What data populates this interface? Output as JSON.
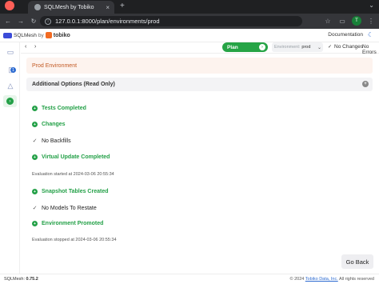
{
  "browser": {
    "tab_title": "SQLMesh by Tobiko",
    "tab_close": "×",
    "new_tab": "+",
    "url": "127.0.0.1:8000/plan/environments/prod",
    "avatar_letter": "T"
  },
  "app": {
    "brand_name": "SQLMesh",
    "brand_by": "by",
    "brand_company": "tobiko",
    "docs_label": "Documentation"
  },
  "sidebar": {
    "badge_count": "1"
  },
  "controls": {
    "back_arrow": "‹",
    "forward_arrow": "›",
    "plan_label": "Plan",
    "environment_label": "Environment:",
    "environment_value": "prod",
    "no_changes": "No Changes",
    "no_errors": "No Errors"
  },
  "main": {
    "prod_environment": "Prod Environment",
    "additional_options": "Additional Options (Read Only)",
    "steps": [
      {
        "label": "Tests Completed"
      },
      {
        "label": "Changes"
      },
      {
        "label": "No Backfills"
      },
      {
        "label": "Virtual Update Completed"
      },
      {
        "label": "Snapshot Tables Created"
      },
      {
        "label": "No Models To Restate"
      },
      {
        "label": "Environment Promoted"
      }
    ],
    "evaluation_started": "Evaluation started at 2024-03-06 20:55:34",
    "evaluation_stopped": "Evaluation stopped at 2024-03-06 20:55:34",
    "go_back": "Go Back"
  },
  "footer": {
    "version_label": "SQLMesh:",
    "version_value": "0.75.2",
    "copyright_prefix": "© 2024",
    "copyright_company": "Tobiko Data, Inc.",
    "copyright_suffix": "All rights reserved"
  },
  "colors": {
    "success": "#23a047",
    "prod_text": "#c25a24",
    "prod_bg": "#fdf3ee",
    "accent": "#2d6bd1"
  }
}
